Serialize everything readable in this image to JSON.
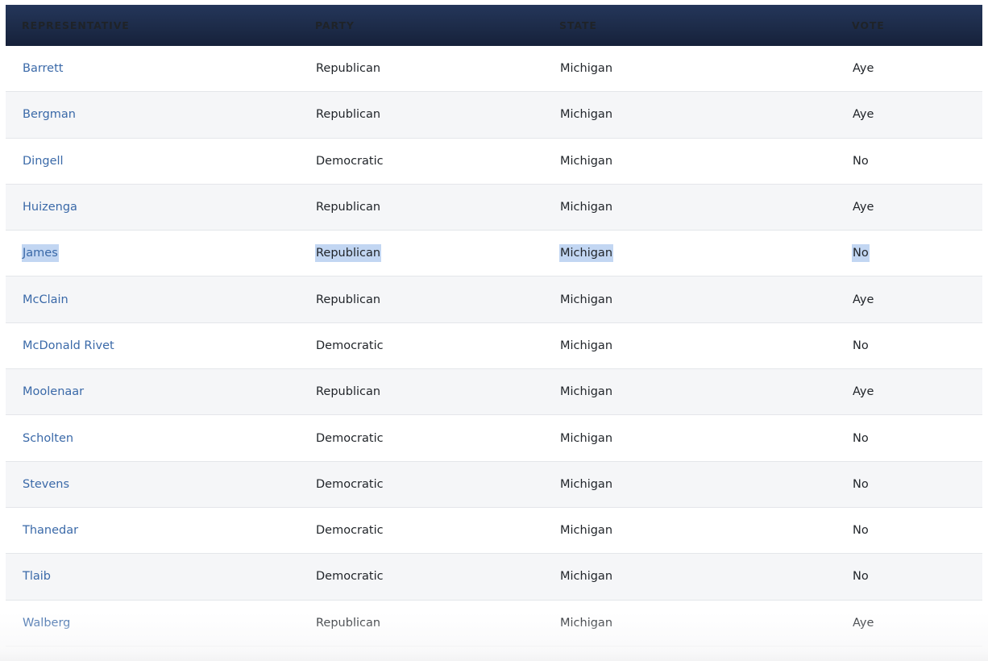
{
  "table": {
    "columns": [
      "REPRESENTATIVE",
      "PARTY",
      "STATE",
      "VOTE"
    ],
    "rows": [
      {
        "representative": "Barrett",
        "party": "Republican",
        "state": "Michigan",
        "vote": "Aye"
      },
      {
        "representative": "Bergman",
        "party": "Republican",
        "state": "Michigan",
        "vote": "Aye"
      },
      {
        "representative": "Dingell",
        "party": "Democratic",
        "state": "Michigan",
        "vote": "No"
      },
      {
        "representative": "Huizenga",
        "party": "Republican",
        "state": "Michigan",
        "vote": "Aye"
      },
      {
        "representative": "James",
        "party": "Republican",
        "state": "Michigan",
        "vote": "No"
      },
      {
        "representative": "McClain",
        "party": "Republican",
        "state": "Michigan",
        "vote": "Aye"
      },
      {
        "representative": "McDonald Rivet",
        "party": "Democratic",
        "state": "Michigan",
        "vote": "No"
      },
      {
        "representative": "Moolenaar",
        "party": "Republican",
        "state": "Michigan",
        "vote": "Aye"
      },
      {
        "representative": "Scholten",
        "party": "Democratic",
        "state": "Michigan",
        "vote": "No"
      },
      {
        "representative": "Stevens",
        "party": "Democratic",
        "state": "Michigan",
        "vote": "No"
      },
      {
        "representative": "Thanedar",
        "party": "Democratic",
        "state": "Michigan",
        "vote": "No"
      },
      {
        "representative": "Tlaib",
        "party": "Democratic",
        "state": "Michigan",
        "vote": "No"
      },
      {
        "representative": "Walberg",
        "party": "Republican",
        "state": "Michigan",
        "vote": "Aye"
      }
    ]
  },
  "colors": {
    "header_bg": "#1c2a47",
    "link": "#3a69a8",
    "selection": "#c2d6f2",
    "alt_row": "#f5f6f8"
  }
}
